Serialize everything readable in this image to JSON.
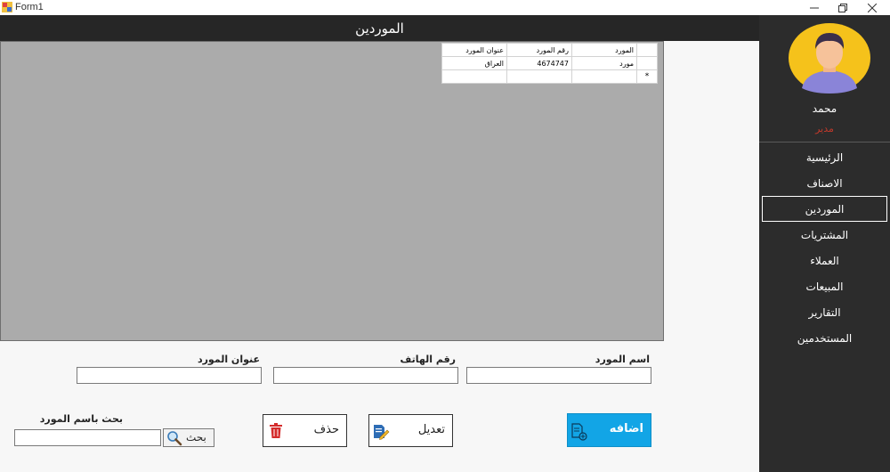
{
  "window": {
    "title": "Form1"
  },
  "header": {
    "title": "الموردين"
  },
  "grid": {
    "columns": [
      "المورد",
      "رقم المورد",
      "عنوان المورد"
    ],
    "rows": [
      [
        "مورد",
        "4674747",
        "العراق"
      ]
    ],
    "new_row_marker": "*"
  },
  "form": {
    "name_label": "اسم المورد",
    "phone_label": "رقم الهاتف",
    "address_label": "عنوان المورد",
    "search_label": "بحث باسم المورد",
    "name_value": "",
    "phone_value": "",
    "address_value": "",
    "search_value": ""
  },
  "buttons": {
    "add": "اضافه",
    "edit": "تعديل",
    "delete": "حذف",
    "search": "بحث"
  },
  "sidebar": {
    "user_name": "محمد",
    "user_role": "مدير",
    "items": [
      {
        "label": "الرئيسية"
      },
      {
        "label": "الاصناف"
      },
      {
        "label": "الموردين"
      },
      {
        "label": "المشتريات"
      },
      {
        "label": "العملاء"
      },
      {
        "label": "المبيعات"
      },
      {
        "label": "التقارير"
      },
      {
        "label": "المستخدمين"
      }
    ],
    "active_index": 2
  },
  "colors": {
    "accent": "#12a5e6",
    "sidebar": "#2c2c2c",
    "header": "#262626",
    "role": "#c0392b"
  }
}
